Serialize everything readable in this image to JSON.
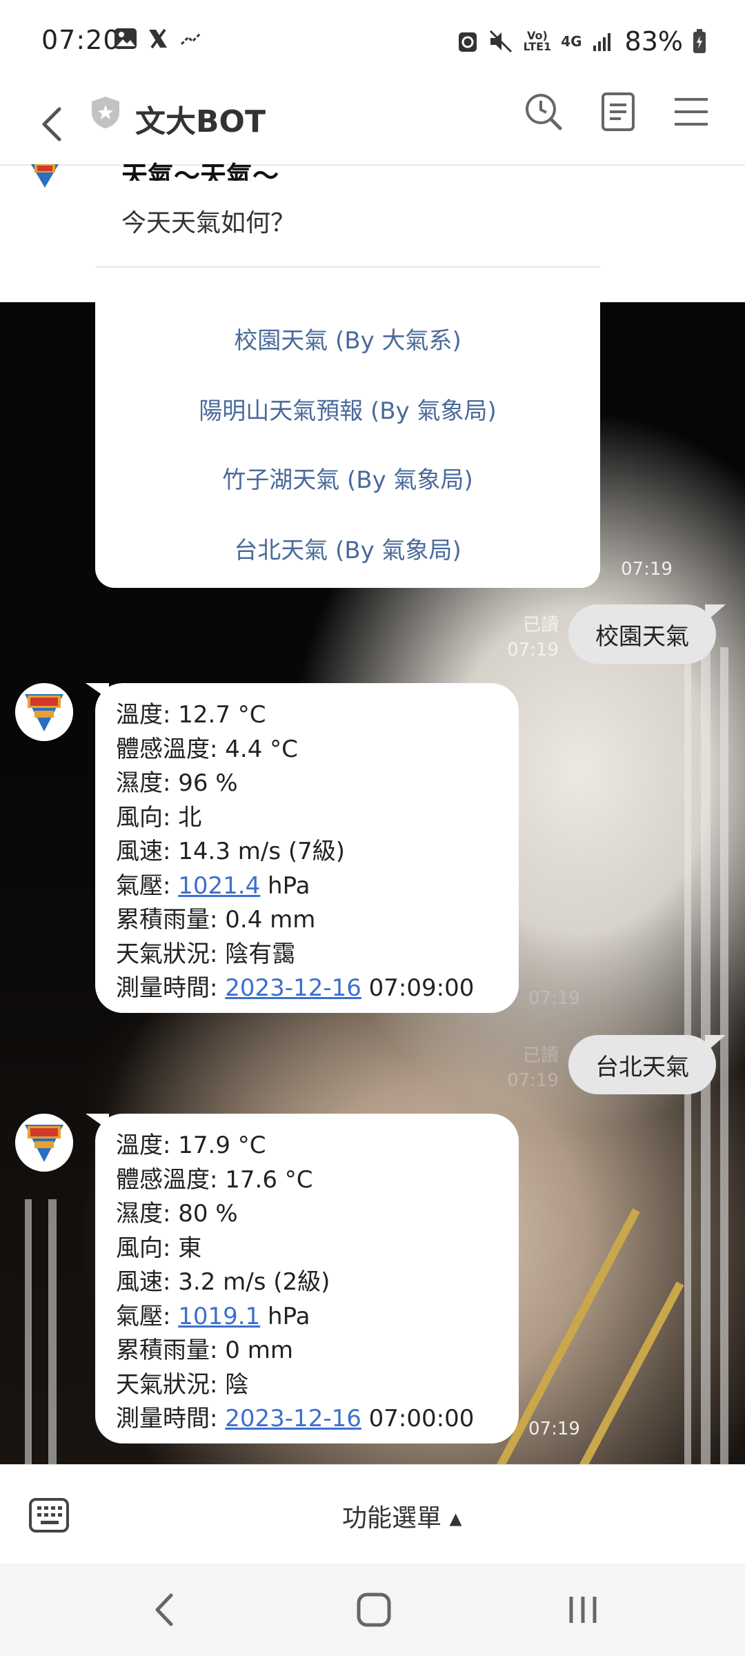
{
  "status_bar": {
    "time": "07:20",
    "network_top": "Vo)",
    "network_bottom": "LTE1",
    "network_type": "4G",
    "battery": "83%"
  },
  "header": {
    "title": "文大BOT"
  },
  "previous_message": {
    "title": "天氣～天氣～",
    "subtitle": "今天天氣如何？"
  },
  "menu_options": [
    "校園天氣 (By 大氣系)",
    "陽明山天氣預報 (By 氣象局)",
    "竹子湖天氣 (By 氣象局)",
    "台北天氣 (By 氣象局)"
  ],
  "menu_time": "07:19",
  "messages": [
    {
      "user_text": "校園天氣",
      "read": "已讀",
      "time": "07:19",
      "reply": {
        "temp": "溫度: 12.7 °C",
        "feel": "體感溫度: 4.4 °C",
        "humidity": "濕度: 96 %",
        "wind_dir": "風向: 北",
        "wind_speed": "風速: 14.3 m/s (7級)",
        "pressure_label": "氣壓: ",
        "pressure_value": "1021.4",
        "pressure_unit": " hPa",
        "rain": "累積雨量: 0.4 mm",
        "condition": "天氣狀況: 陰有靄",
        "measure_label": "測量時間: ",
        "measure_date": "2023-12-16",
        "measure_time": " 07:09:00",
        "time": "07:19"
      }
    },
    {
      "user_text": "台北天氣",
      "read": "已讀",
      "time": "07:19",
      "reply": {
        "temp": "溫度: 17.9 °C",
        "feel": "體感溫度: 17.6 °C",
        "humidity": "濕度: 80 %",
        "wind_dir": "風向: 東",
        "wind_speed": "風速: 3.2 m/s (2級)",
        "pressure_label": "氣壓: ",
        "pressure_value": "1019.1",
        "pressure_unit": " hPa",
        "rain": "累積雨量: 0 mm",
        "condition": "天氣狀況: 陰",
        "measure_label": "測量時間: ",
        "measure_date": "2023-12-16",
        "measure_time": " 07:00:00",
        "time": "07:19"
      }
    }
  ],
  "bottom_bar": {
    "function_menu": "功能選單 ▴"
  },
  "colors": {
    "link": "#3d6fce",
    "menu_text": "#4a6a9a",
    "bubble_user": "#e6e6e6"
  }
}
